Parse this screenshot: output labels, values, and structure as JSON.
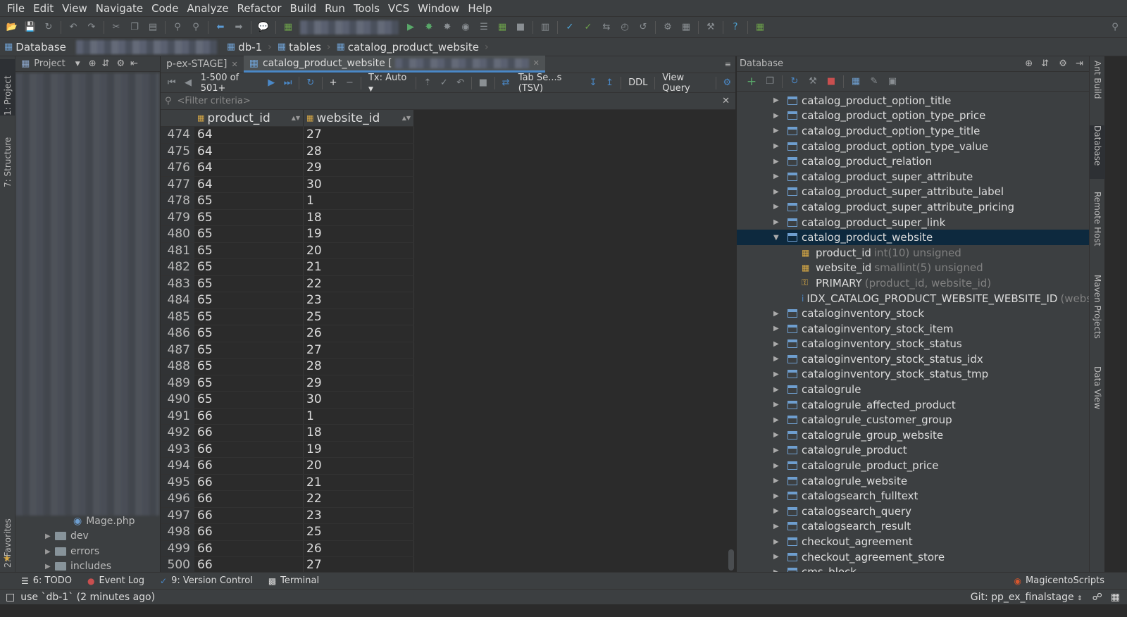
{
  "menu": [
    "File",
    "Edit",
    "View",
    "Navigate",
    "Code",
    "Analyze",
    "Refactor",
    "Build",
    "Run",
    "Tools",
    "VCS",
    "Window",
    "Help"
  ],
  "breadcrumb": {
    "root": "Database",
    "db": "db-1",
    "tables": "tables",
    "table": "catalog_product_website"
  },
  "project_panel": {
    "title": "Project",
    "visible_items": [
      {
        "label": "Mage.php"
      },
      {
        "label": "dev"
      },
      {
        "label": "errors"
      },
      {
        "label": "includes"
      }
    ]
  },
  "left_tabs": [
    "1: Project",
    "7: Structure",
    "2: Favorites"
  ],
  "editor": {
    "tabs": [
      {
        "label": "p-ex-STAGE]"
      },
      {
        "label": "catalog_product_website ["
      }
    ]
  },
  "grid_toolbar": {
    "page_info": "1-500 of 501+",
    "tx": "Tx: Auto",
    "format": "Tab Se...s (TSV)",
    "ddl": "DDL",
    "view_query": "View Query"
  },
  "filter": {
    "placeholder": "<Filter criteria>"
  },
  "grid": {
    "columns": [
      "product_id",
      "website_id"
    ],
    "rows": [
      [
        474,
        64,
        27
      ],
      [
        475,
        64,
        28
      ],
      [
        476,
        64,
        29
      ],
      [
        477,
        64,
        30
      ],
      [
        478,
        65,
        1
      ],
      [
        479,
        65,
        18
      ],
      [
        480,
        65,
        19
      ],
      [
        481,
        65,
        20
      ],
      [
        482,
        65,
        21
      ],
      [
        483,
        65,
        22
      ],
      [
        484,
        65,
        23
      ],
      [
        485,
        65,
        25
      ],
      [
        486,
        65,
        26
      ],
      [
        487,
        65,
        27
      ],
      [
        488,
        65,
        28
      ],
      [
        489,
        65,
        29
      ],
      [
        490,
        65,
        30
      ],
      [
        491,
        66,
        1
      ],
      [
        492,
        66,
        18
      ],
      [
        493,
        66,
        19
      ],
      [
        494,
        66,
        20
      ],
      [
        495,
        66,
        21
      ],
      [
        496,
        66,
        22
      ],
      [
        497,
        66,
        23
      ],
      [
        498,
        66,
        25
      ],
      [
        499,
        66,
        26
      ],
      [
        500,
        66,
        27
      ]
    ]
  },
  "db_panel": {
    "title": "Database",
    "tree": [
      {
        "label": "catalog_product_option_title",
        "kind": "table"
      },
      {
        "label": "catalog_product_option_type_price",
        "kind": "table"
      },
      {
        "label": "catalog_product_option_type_title",
        "kind": "table"
      },
      {
        "label": "catalog_product_option_type_value",
        "kind": "table"
      },
      {
        "label": "catalog_product_relation",
        "kind": "table"
      },
      {
        "label": "catalog_product_super_attribute",
        "kind": "table"
      },
      {
        "label": "catalog_product_super_attribute_label",
        "kind": "table"
      },
      {
        "label": "catalog_product_super_attribute_pricing",
        "kind": "table"
      },
      {
        "label": "catalog_product_super_link",
        "kind": "table"
      },
      {
        "label": "catalog_product_website",
        "kind": "table",
        "expanded": true,
        "selected": true
      },
      {
        "label": "product_id",
        "type": "int(10) unsigned",
        "kind": "column"
      },
      {
        "label": "website_id",
        "type": "smallint(5) unsigned",
        "kind": "column"
      },
      {
        "label": "PRIMARY",
        "type": "(product_id, website_id)",
        "kind": "key"
      },
      {
        "label": "IDX_CATALOG_PRODUCT_WEBSITE_WEBSITE_ID",
        "type": "(website",
        "kind": "index"
      },
      {
        "label": "cataloginventory_stock",
        "kind": "table"
      },
      {
        "label": "cataloginventory_stock_item",
        "kind": "table"
      },
      {
        "label": "cataloginventory_stock_status",
        "kind": "table"
      },
      {
        "label": "cataloginventory_stock_status_idx",
        "kind": "table"
      },
      {
        "label": "cataloginventory_stock_status_tmp",
        "kind": "table"
      },
      {
        "label": "catalogrule",
        "kind": "table"
      },
      {
        "label": "catalogrule_affected_product",
        "kind": "table"
      },
      {
        "label": "catalogrule_customer_group",
        "kind": "table"
      },
      {
        "label": "catalogrule_group_website",
        "kind": "table"
      },
      {
        "label": "catalogrule_product",
        "kind": "table"
      },
      {
        "label": "catalogrule_product_price",
        "kind": "table"
      },
      {
        "label": "catalogrule_website",
        "kind": "table"
      },
      {
        "label": "catalogsearch_fulltext",
        "kind": "table"
      },
      {
        "label": "catalogsearch_query",
        "kind": "table"
      },
      {
        "label": "catalogsearch_result",
        "kind": "table"
      },
      {
        "label": "checkout_agreement",
        "kind": "table"
      },
      {
        "label": "checkout_agreement_store",
        "kind": "table"
      },
      {
        "label": "cms_block",
        "kind": "table"
      }
    ]
  },
  "right_tabs": [
    "Ant Build",
    "Database",
    "Remote Host",
    "Maven Projects",
    "Data View"
  ],
  "bottom_tools": [
    "6: TODO",
    "Event Log",
    "9: Version Control",
    "Terminal",
    "MagicentoScripts"
  ],
  "status": {
    "message": "use `db-1` (2 minutes ago)",
    "git": "Git: pp_ex_finalstage"
  },
  "colors": {
    "background": "#2b2b2b",
    "panel": "#3c3f41",
    "selection": "#0d293e",
    "accent": "#4a88c7"
  }
}
